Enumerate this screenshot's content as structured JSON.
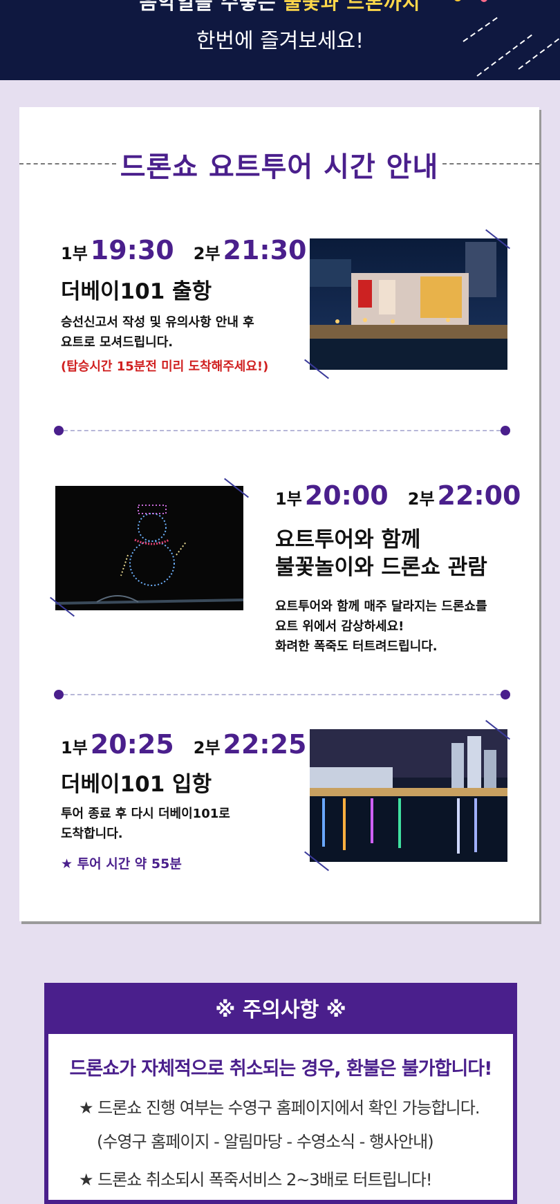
{
  "banner": {
    "line1_pre": "음악일을 수놓는 ",
    "line1_hl": "불꽃과 드론까지",
    "line2": "한번에 즐겨보세요!"
  },
  "card": {
    "title": "드론쇼 요트투어 시간 안내",
    "blocks": [
      {
        "part1_label": "1부",
        "part1_time": "19:30",
        "part2_label": "2부",
        "part2_time": "21:30",
        "heading": "더베이101 출항",
        "desc": [
          "승선신고서 작성 및 유의사항 안내 후",
          "요트로 모셔드립니다."
        ],
        "notice": "(탑승시간 15분전 미리 도착해주세요!)"
      },
      {
        "part1_label": "1부",
        "part1_time": "20:00",
        "part2_label": "2부",
        "part2_time": "22:00",
        "heading": [
          "요트투어와 함께",
          "불꽃놀이와 드론쇼 관람"
        ],
        "desc": [
          "요트투어와 함께 매주 달라지는 드론쇼를",
          "요트 위에서 감상하세요!",
          "화려한 폭죽도 터트려드립니다."
        ]
      },
      {
        "part1_label": "1부",
        "part1_time": "20:25",
        "part2_label": "2부",
        "part2_time": "22:25",
        "heading": "더베이101 입항",
        "desc": [
          "투어 종료 후 다시 더베이101로",
          "도착합니다."
        ],
        "note": "★ 투어 시간 약 55분"
      }
    ]
  },
  "caution": {
    "header": "※ 주의사항 ※",
    "warning": "드론쇼가 자체적으로 취소되는 경우, 환불은 불가합니다!",
    "item1": "★ 드론쇼 진행 여부는 수영구 홈페이지에서 확인 가능합니다.",
    "item1_sub": "(수영구 홈페이지 - 알림마당 - 수영소식 - 행사안내)",
    "item2": "★ 드론쇼 취소되시 폭죽서비스 2~3배로 터트립니다!"
  },
  "colors": {
    "accent": "#4a1f8c",
    "notice_red": "#d02020",
    "banner_bg": "#0f1840",
    "page_bg": "#e6dff0"
  },
  "icons": [
    "firework-decoration",
    "star-bullet",
    "reference-mark"
  ]
}
